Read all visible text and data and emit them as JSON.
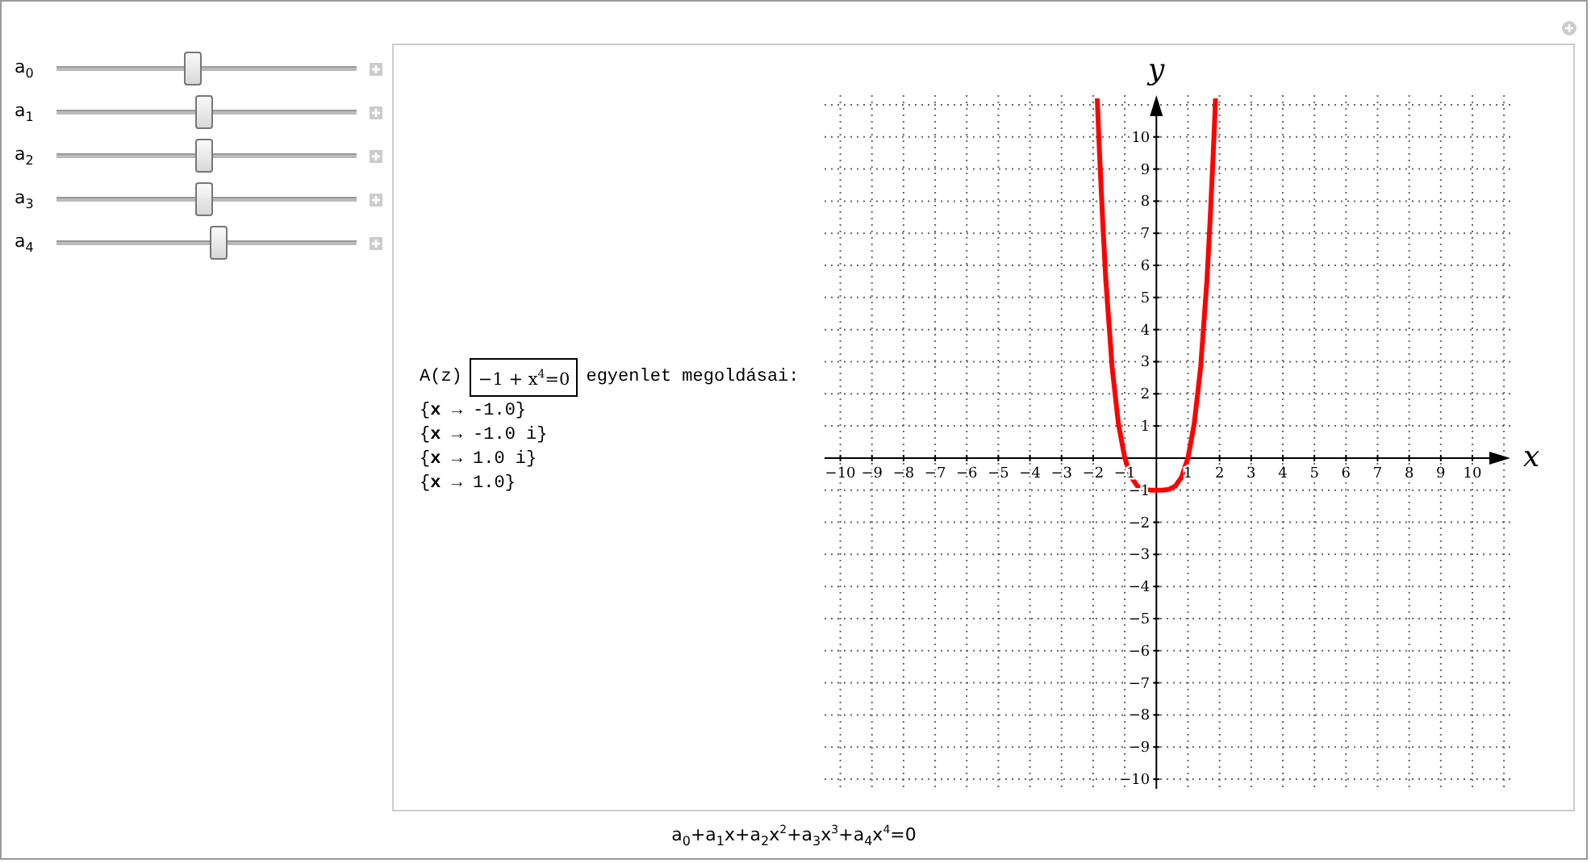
{
  "sliders": [
    {
      "label": "a$_{0}$",
      "level": 0.45
    },
    {
      "label": "a$_{1}$",
      "level": 0.49
    },
    {
      "label": "a$_{2}$",
      "level": 0.49
    },
    {
      "label": "a$_{3}$",
      "level": 0.49
    },
    {
      "label": "a$_{4}$",
      "level": 0.54
    }
  ],
  "output": {
    "prefix": "A(z)",
    "equation": "−1 + x$^{4}$=0",
    "suffix": "egyenlet megoldásai:",
    "solutions": [
      "{**x** → -1.0}",
      "{**x** → -1.0 i}",
      "{**x** → 1.0 i}",
      "{**x** → 1.0}"
    ]
  },
  "plot": {
    "chart_data": {
      "type": "line",
      "xlabel": "x",
      "ylabel": "y",
      "xlim": [
        -10.5,
        11.2
      ],
      "ylim": [
        -10.3,
        11.3
      ],
      "x": [
        -1.87,
        -1.8,
        -1.7,
        -1.6,
        -1.4,
        -1.2,
        -1,
        -0.8,
        -0.6,
        -0.4,
        -0.2,
        0,
        0.2,
        0.4,
        0.6,
        0.8,
        1,
        1.2,
        1.4,
        1.6,
        1.7,
        1.8,
        1.87
      ],
      "grid": true,
      "series": [
        {
          "color": "#ff0000",
          "values": [
            11.2,
            9.5,
            7.35,
            5.55,
            2.84,
            1.07,
            0,
            -0.59,
            -0.87,
            -0.97,
            -1,
            -1,
            -1,
            -0.97,
            -0.87,
            -0.59,
            0,
            1.07,
            2.84,
            5.55,
            7.35,
            9.5,
            11.2
          ]
        }
      ],
      "xticks": [
        {
          "value": -10,
          "label": "−10"
        },
        {
          "value": -9,
          "label": "−9"
        },
        {
          "value": -8,
          "label": "−8"
        },
        {
          "value": -7,
          "label": "−7"
        },
        {
          "value": -6,
          "label": "−6"
        },
        {
          "value": -5,
          "label": "−5"
        },
        {
          "value": -4,
          "label": "−4"
        },
        {
          "value": -3,
          "label": "−3"
        },
        {
          "value": -2,
          "label": "−2"
        },
        {
          "value": -1,
          "label": "−1"
        },
        1,
        2,
        3,
        4,
        5,
        6,
        7,
        8,
        9,
        10
      ],
      "yticks": [
        {
          "value": -10,
          "label": "−10"
        },
        {
          "value": -9,
          "label": "−9"
        },
        {
          "value": -8,
          "label": "−8"
        },
        {
          "value": -7,
          "label": "−7"
        },
        {
          "value": -6,
          "label": "−6"
        },
        {
          "value": -5,
          "label": "−5"
        },
        {
          "value": -4,
          "label": "−4"
        },
        {
          "value": -3,
          "label": "−3"
        },
        {
          "value": -2,
          "label": "−2"
        },
        {
          "value": -1,
          "label": "−1"
        },
        1,
        2,
        3,
        4,
        5,
        6,
        7,
        8,
        9,
        10
      ]
    }
  },
  "caption": "a$_{0}$+a$_{1}$x+a$_{2}$x$^{2}$+a$_{3}$x$^{3}$+a$_{4}$x$^{4}$=0"
}
